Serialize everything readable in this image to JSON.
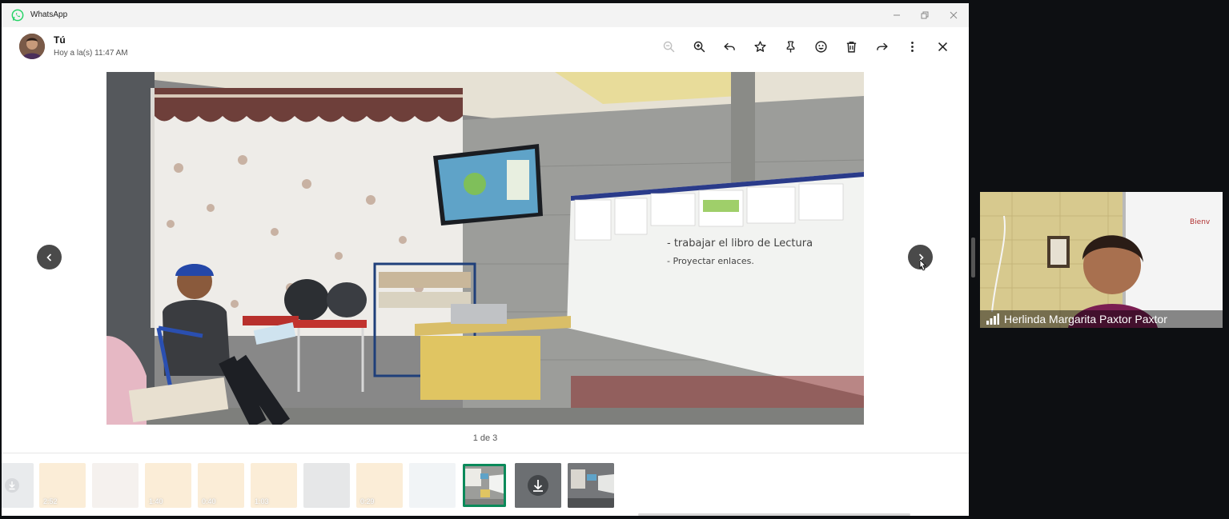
{
  "window": {
    "app_title": "WhatsApp"
  },
  "viewer": {
    "sender_name": "Tú",
    "timestamp": "Hoy a la(s) 11:47 AM",
    "toolbar": [
      {
        "id": "zoom-out",
        "icon": "zoom-out-icon",
        "enabled": false
      },
      {
        "id": "zoom-in",
        "icon": "zoom-in-icon",
        "enabled": true
      },
      {
        "id": "reply",
        "icon": "reply-icon",
        "enabled": true
      },
      {
        "id": "star",
        "icon": "star-icon",
        "enabled": true
      },
      {
        "id": "pin",
        "icon": "pin-icon",
        "enabled": true
      },
      {
        "id": "react",
        "icon": "emoji-icon",
        "enabled": true
      },
      {
        "id": "delete",
        "icon": "trash-icon",
        "enabled": true
      },
      {
        "id": "forward",
        "icon": "forward-icon",
        "enabled": true
      },
      {
        "id": "more",
        "icon": "more-vertical-icon",
        "enabled": true
      },
      {
        "id": "close",
        "icon": "close-icon",
        "enabled": true
      }
    ],
    "counter": "1 de 3"
  },
  "thumbnails": [
    {
      "kind": "download",
      "duration": ""
    },
    {
      "kind": "audio",
      "duration": "2:52"
    },
    {
      "kind": "image",
      "duration": ""
    },
    {
      "kind": "audio",
      "duration": "1:40"
    },
    {
      "kind": "audio",
      "duration": "0:40"
    },
    {
      "kind": "audio",
      "duration": "1:03"
    },
    {
      "kind": "image",
      "duration": ""
    },
    {
      "kind": "audio",
      "duration": "0:29"
    },
    {
      "kind": "image",
      "duration": ""
    },
    {
      "kind": "image",
      "duration": "",
      "selected": true
    },
    {
      "kind": "download",
      "duration": ""
    },
    {
      "kind": "image",
      "duration": ""
    }
  ],
  "video_call": {
    "participant_name": "Herlinda Margarita Paxtor Paxtor"
  },
  "colors": {
    "accent_green": "#0a8a5a",
    "whatsapp_green": "#25d366"
  }
}
